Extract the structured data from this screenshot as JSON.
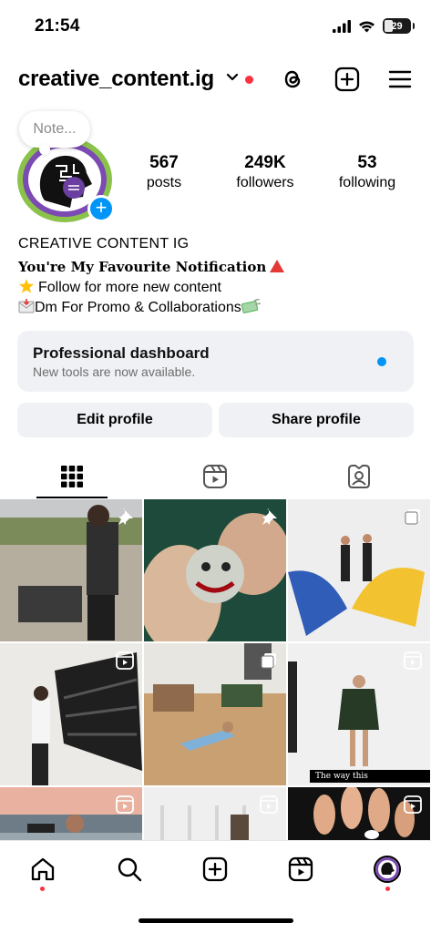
{
  "status_bar": {
    "time": "21:54",
    "battery_level": "29",
    "icons": [
      "cellular-signal-icon",
      "wifi-icon",
      "battery-icon"
    ]
  },
  "header": {
    "username": "creative_content.ig",
    "has_notification_dot": true,
    "icons": [
      "chevron-down-icon",
      "threads-icon",
      "new-post-icon",
      "menu-icon"
    ]
  },
  "profile": {
    "note_placeholder": "Note...",
    "stats": [
      {
        "value": "567",
        "label": "posts"
      },
      {
        "value": "249K",
        "label": "followers"
      },
      {
        "value": "53",
        "label": "following"
      }
    ],
    "display_name": "CREATIVE CONTENT IG",
    "bio_lines": [
      "You're My Favourite Notification",
      "Follow for more new content",
      "Dm For Promo & Collaborations"
    ]
  },
  "dashboard": {
    "title": "Professional dashboard",
    "subtitle": "New tools are now available."
  },
  "buttons": {
    "edit_profile": "Edit profile",
    "share_profile": "Share profile"
  },
  "tabs": [
    {
      "name": "posts-grid-tab",
      "icon": "grid-icon",
      "active": true
    },
    {
      "name": "reels-tab",
      "icon": "reels-icon",
      "active": false
    },
    {
      "name": "tagged-tab",
      "icon": "tagged-person-icon",
      "active": false
    }
  ],
  "grid": {
    "posts": [
      {
        "badge": "pin-icon"
      },
      {
        "badge": "pin-icon"
      },
      {
        "badge": "carousel-icon"
      },
      {
        "badge": "reels-icon"
      },
      {
        "badge": "carousel-icon"
      },
      {
        "badge": "reels-icon",
        "caption": "The way this photographer"
      },
      {
        "badge": "reels-icon"
      },
      {
        "badge": "reels-icon"
      },
      {
        "badge": "reels-icon"
      }
    ]
  },
  "bottom_nav": {
    "items": [
      "home-icon",
      "search-icon",
      "create-icon",
      "reels-icon",
      "profile-avatar"
    ]
  },
  "colors": {
    "accent_blue": "#0095f6",
    "notification_red": "#ff3040",
    "button_bg": "#eff1f5"
  }
}
